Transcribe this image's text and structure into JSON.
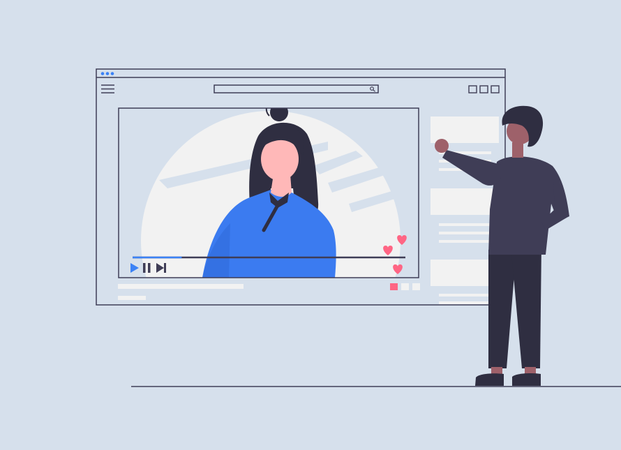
{
  "colors": {
    "background": "#d6e0ec",
    "outline": "#3f3d56",
    "accent": "#3b82f6",
    "shirt": "#3b7bf0",
    "hair": "#2f2e41",
    "skin_light": "#ffb8b8",
    "skin_dark": "#9e616a",
    "heart": "#ff6584",
    "placeholder": "#f2f2f2",
    "jacket": "#3f3d56",
    "pants": "#2f2e41"
  },
  "browser": {
    "window_dots": [
      "dot",
      "dot",
      "dot"
    ],
    "menu_icon": "hamburger-menu-icon",
    "search_icon": "magnifier-icon",
    "window_controls": [
      "minimize",
      "maximize",
      "close"
    ]
  },
  "player": {
    "progress": 0.18,
    "controls": [
      "play-icon",
      "pause-icon",
      "skip-next-icon"
    ],
    "hearts": 3,
    "pagination": {
      "count": 3,
      "active": 1
    }
  },
  "sidebar": {
    "cards": 3
  }
}
